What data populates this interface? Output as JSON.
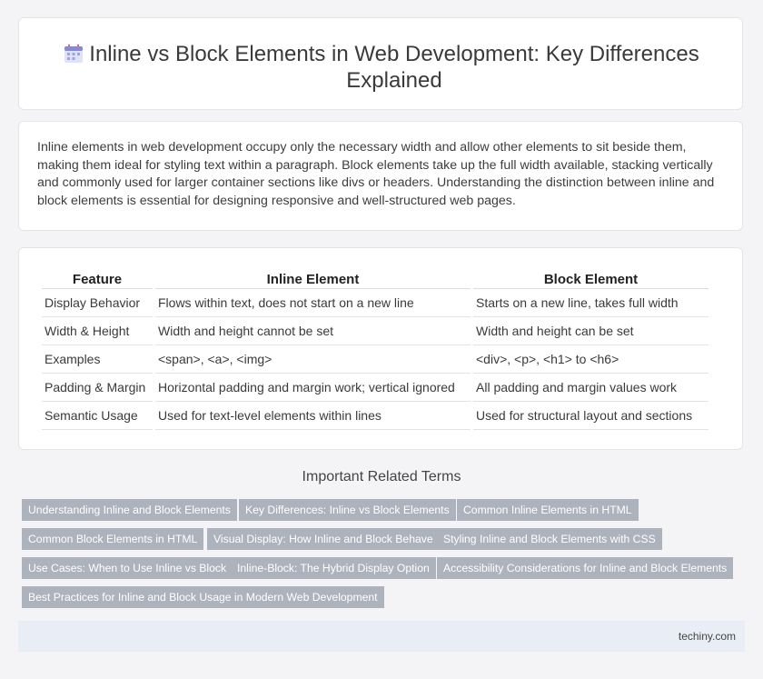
{
  "header": {
    "icon": "calendar-icon",
    "title": "Inline vs Block Elements in Web Development: Key Differences Explained"
  },
  "intro": {
    "text": "Inline elements in web development occupy only the necessary width and allow other elements to sit beside them, making them ideal for styling text within a paragraph. Block elements take up the full width available, stacking vertically and commonly used for larger container sections like divs or headers. Understanding the distinction between inline and block elements is essential for designing responsive and well-structured web pages."
  },
  "table": {
    "headers": [
      "Feature",
      "Inline Element",
      "Block Element"
    ],
    "rows": [
      [
        "Display Behavior",
        "Flows within text, does not start on a new line",
        "Starts on a new line, takes full width"
      ],
      [
        "Width & Height",
        "Width and height cannot be set",
        "Width and height can be set"
      ],
      [
        "Examples",
        "<span>, <a>, <img>",
        "<div>, <p>, <h1> to <h6>"
      ],
      [
        "Padding & Margin",
        "Horizontal padding and margin work; vertical ignored",
        "All padding and margin values work"
      ],
      [
        "Semantic Usage",
        "Used for text-level elements within lines",
        "Used for structural layout and sections"
      ]
    ]
  },
  "related": {
    "title": "Important Related Terms",
    "tags": [
      "Understanding Inline and Block Elements",
      "Key Differences: Inline vs Block Elements",
      "Common Inline Elements in HTML",
      "Common Block Elements in HTML",
      "Visual Display: How Inline and Block Behave",
      "Styling Inline and Block Elements with CSS",
      "Use Cases: When to Use Inline vs Block",
      "Inline-Block: The Hybrid Display Option",
      "Accessibility Considerations for Inline and Block Elements",
      "Best Practices for Inline and Block Usage in Modern Web Development"
    ]
  },
  "footer": {
    "site": "techiny.com"
  }
}
